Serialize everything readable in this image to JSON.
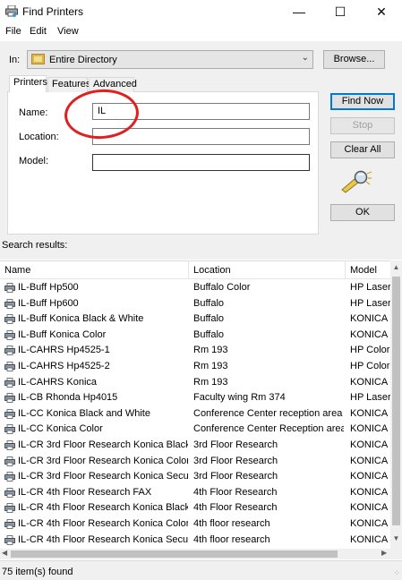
{
  "window": {
    "title": "Find Printers",
    "minimize": "—",
    "maximize": "☐",
    "close": "✕"
  },
  "menu": [
    "File",
    "Edit",
    "View"
  ],
  "in_field": {
    "label": "In:",
    "value": "Entire Directory",
    "browse_label": "Browse..."
  },
  "tabs": [
    "Printers",
    "Features",
    "Advanced"
  ],
  "fields": {
    "name": {
      "label": "Name:",
      "value": "IL"
    },
    "location": {
      "label": "Location:",
      "value": ""
    },
    "model": {
      "label": "Model:",
      "value": ""
    }
  },
  "buttons": {
    "find_now": "Find Now",
    "stop": "Stop",
    "clear_all": "Clear All",
    "ok": "OK"
  },
  "results_label": "Search results:",
  "columns": [
    "Name",
    "Location",
    "Model"
  ],
  "rows": [
    [
      "IL-Buff Hp500",
      "Buffalo Color",
      "HP LaserJ"
    ],
    [
      "IL-Buff Hp600",
      "Buffalo",
      "HP LaserJ"
    ],
    [
      "IL-Buff Konica Black & White",
      "Buffalo",
      "KONICA N"
    ],
    [
      "IL-Buff Konica Color",
      "Buffalo",
      "KONICA N"
    ],
    [
      "IL-CAHRS Hp4525-1",
      "Rm 193",
      "HP Color"
    ],
    [
      "IL-CAHRS Hp4525-2",
      "Rm 193",
      "HP Color"
    ],
    [
      "IL-CAHRS Konica",
      "Rm 193",
      "KONICA N"
    ],
    [
      "IL-CB Rhonda Hp4015",
      "Faculty wing Rm 374",
      "HP LaserJ"
    ],
    [
      "IL-CC Konica Black and White",
      "Conference Center reception area",
      "KONICA N"
    ],
    [
      "IL-CC Konica Color",
      "Conference Center Reception area",
      "KONICA N"
    ],
    [
      "IL-CR 3rd Floor Research Konica Black ...",
      "3rd Floor Research",
      "KONICA N"
    ],
    [
      "IL-CR 3rd Floor Research Konica Color",
      "3rd Floor Research",
      "KONICA N"
    ],
    [
      "IL-CR 3rd Floor Research Konica Secure...",
      "3rd Floor Research",
      "KONICA N"
    ],
    [
      "IL-CR 4th Floor Research FAX",
      "4th Floor Research",
      "KONICA N"
    ],
    [
      "IL-CR 4th Floor Research Konica Black ...",
      "4th Floor Research",
      "KONICA N"
    ],
    [
      "IL-CR 4th Floor Research Konica Color",
      "4th floor research",
      "KONICA N"
    ],
    [
      "IL-CR 4th Floor Research Konica Secure...",
      "4th floor research",
      "KONICA N"
    ]
  ],
  "status": "75 item(s) found",
  "colors": {
    "annotation": "#e02020",
    "default_button_border": "#0078d7"
  }
}
